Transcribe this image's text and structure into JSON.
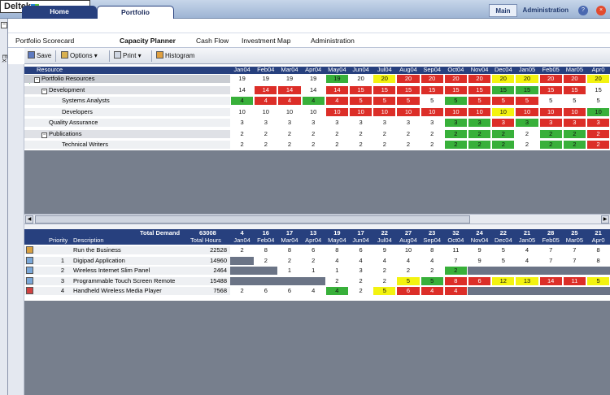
{
  "header": {
    "logo_text": "Deltek",
    "tabs": [
      {
        "label": "Home"
      },
      {
        "label": "Portfolio"
      }
    ],
    "right_links": [
      {
        "label": "Main"
      },
      {
        "label": "Administration"
      }
    ]
  },
  "explorer": {
    "label": "Explorer"
  },
  "subnav": [
    "Portfolio Scorecard",
    "Capacity Planner",
    "Cash Flow",
    "Investment Map",
    "Administration"
  ],
  "toolbar": {
    "save": "Save",
    "options": "Options",
    "print": "Print",
    "histogram": "Histogram"
  },
  "months": [
    "Jan04",
    "Feb04",
    "Mar04",
    "Apr04",
    "May04",
    "Jun04",
    "Jul04",
    "Aug04",
    "Sep04",
    "Oct04",
    "Nov04",
    "Dec04",
    "Jan05",
    "Feb05",
    "Mar05",
    "Apr0"
  ],
  "capacity": {
    "header": "Resource",
    "rows": [
      {
        "label": "Portfolio Resources",
        "level": 0,
        "expander": "−",
        "values": [
          "19",
          "19",
          "19",
          "19",
          "19",
          "20",
          "20",
          "20",
          "20",
          "20",
          "20",
          "20",
          "20",
          "20",
          "20",
          "20"
        ],
        "colors": "WWWWGWYRRRRYYRRY"
      },
      {
        "label": "Development",
        "level": 1,
        "expander": "−",
        "values": [
          "14",
          "14",
          "14",
          "14",
          "14",
          "15",
          "15",
          "15",
          "15",
          "15",
          "15",
          "15",
          "15",
          "15",
          "15",
          "15"
        ],
        "colors": "WRRWRRRRRRRGGRRW"
      },
      {
        "label": "Systems Analysts",
        "level": 2,
        "expander": "",
        "values": [
          "4",
          "4",
          "4",
          "4",
          "4",
          "5",
          "5",
          "5",
          "5",
          "5",
          "5",
          "5",
          "5",
          "5",
          "5",
          "5"
        ],
        "colors": "GRRGRRRRWGRRRWWW"
      },
      {
        "label": "Developers",
        "level": 2,
        "expander": "",
        "values": [
          "10",
          "10",
          "10",
          "10",
          "10",
          "10",
          "10",
          "10",
          "10",
          "10",
          "10",
          "10",
          "10",
          "10",
          "10",
          "10"
        ],
        "colors": "WWWWRRRRRRRYRRRG"
      },
      {
        "label": "Quality Assurance",
        "level": 1,
        "expander": "",
        "values": [
          "3",
          "3",
          "3",
          "3",
          "3",
          "3",
          "3",
          "3",
          "3",
          "3",
          "3",
          "3",
          "3",
          "3",
          "3",
          "3"
        ],
        "colors": "WWWWWWWWWGGRGRRR"
      },
      {
        "label": "Publications",
        "level": 1,
        "expander": "−",
        "values": [
          "2",
          "2",
          "2",
          "2",
          "2",
          "2",
          "2",
          "2",
          "2",
          "2",
          "2",
          "2",
          "2",
          "2",
          "2",
          "2"
        ],
        "colors": "WWWWWWWWWGGGWGGR"
      },
      {
        "label": "Technical Writers",
        "level": 2,
        "expander": "",
        "values": [
          "2",
          "2",
          "2",
          "2",
          "2",
          "2",
          "2",
          "2",
          "2",
          "2",
          "2",
          "2",
          "2",
          "2",
          "2",
          "2"
        ],
        "colors": "WWWWWWWWWGGGWGGR"
      }
    ]
  },
  "demand": {
    "total_label": "Total Demand",
    "total_hours": "63008",
    "totals": [
      "4",
      "16",
      "17",
      "13",
      "19",
      "17",
      "22",
      "27",
      "23",
      "32",
      "24",
      "22",
      "21",
      "28",
      "25",
      "21"
    ],
    "col_priority": "Priority",
    "col_description": "Description",
    "col_hours": "Total Hours",
    "rows": [
      {
        "priority": "",
        "description": "Run the Business",
        "hours": "22528",
        "values": [
          "2",
          "8",
          "8",
          "6",
          "8",
          "6",
          "9",
          "10",
          "8",
          "11",
          "9",
          "5",
          "4",
          "7",
          "7",
          "8"
        ],
        "colors": "WWWWWWWWWWWWWWWW",
        "icon": "#d9a040"
      },
      {
        "priority": "1",
        "description": "Digipad Application",
        "hours": "14960",
        "values": [
          "",
          "2",
          "2",
          "2",
          "4",
          "4",
          "4",
          "4",
          "4",
          "7",
          "9",
          "5",
          "4",
          "7",
          "7",
          "8"
        ],
        "colors": "DWWWWWWWWWWWWWWW",
        "icon": "#7aa7d8"
      },
      {
        "priority": "2",
        "description": "Wireless Internet Slim Panel",
        "hours": "2464",
        "values": [
          "",
          "",
          "1",
          "1",
          "1",
          "3",
          "2",
          "2",
          "2",
          "2",
          "",
          "",
          "",
          "",
          "",
          ""
        ],
        "colors": "DDWWWWWWWGDDDDDD",
        "icon": "#7aa7d8"
      },
      {
        "priority": "3",
        "description": "Programmable Touch Screen Remote",
        "hours": "15488",
        "values": [
          "",
          "",
          "",
          "",
          "2",
          "2",
          "2",
          "5",
          "5",
          "8",
          "6",
          "12",
          "13",
          "14",
          "11",
          "5"
        ],
        "colors": "DDDDWWWYGRRYYRRY",
        "icon": "#7aa7d8"
      },
      {
        "priority": "4",
        "description": "Handheld Wireless Media Player",
        "hours": "7568",
        "values": [
          "2",
          "6",
          "6",
          "4",
          "4",
          "2",
          "5",
          "6",
          "4",
          "4",
          "",
          "",
          "",
          "",
          "",
          ""
        ],
        "colors": "WWWWGWYRRRDDDDDD",
        "icon": "#d04040"
      }
    ]
  }
}
